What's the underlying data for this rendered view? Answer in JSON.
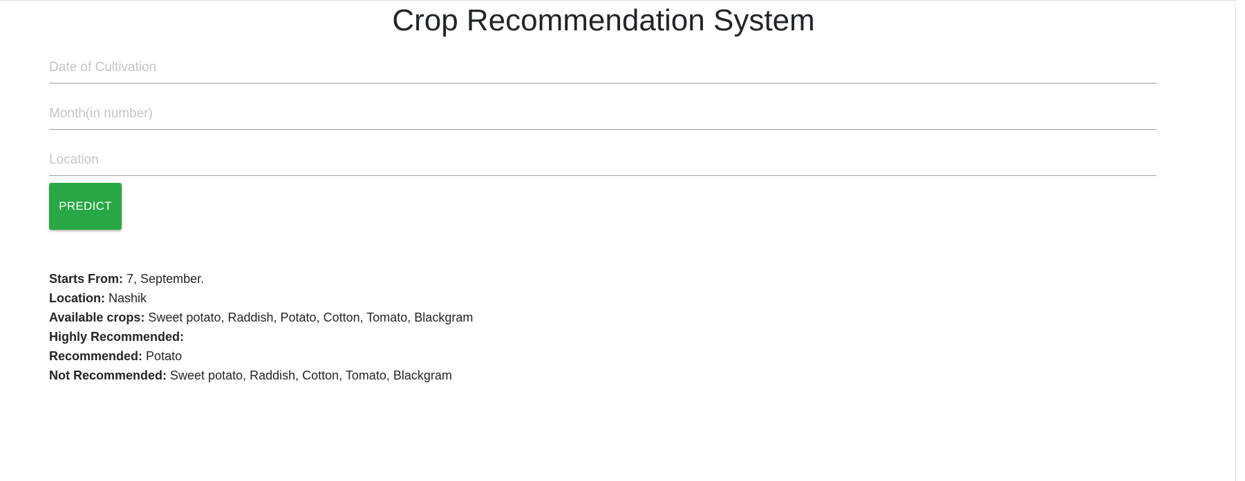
{
  "page": {
    "title": "Crop Recommendation System"
  },
  "form": {
    "date_placeholder": "Date of Cultivation",
    "date_value": "",
    "month_placeholder": "Month(in number)",
    "month_value": "",
    "location_placeholder": "Location",
    "location_value": "",
    "predict_label": "PREDICT"
  },
  "results": {
    "starts_from": {
      "label": "Starts From:",
      "value": "7, September."
    },
    "location": {
      "label": "Location:",
      "value": "Nashik"
    },
    "available_crops": {
      "label": "Available crops:",
      "value": "Sweet potato, Raddish, Potato, Cotton, Tomato, Blackgram"
    },
    "highly_recommended": {
      "label": "Highly Recommended:",
      "value": ""
    },
    "recommended": {
      "label": "Recommended:",
      "value": "Potato"
    },
    "not_recommended": {
      "label": "Not Recommended:",
      "value": "Sweet potato, Raddish, Cotton, Tomato, Blackgram"
    }
  },
  "colors": {
    "accent_button": "#28a745",
    "text": "#212529",
    "placeholder": "#c4c4c4",
    "underline": "#9e9e9e"
  }
}
